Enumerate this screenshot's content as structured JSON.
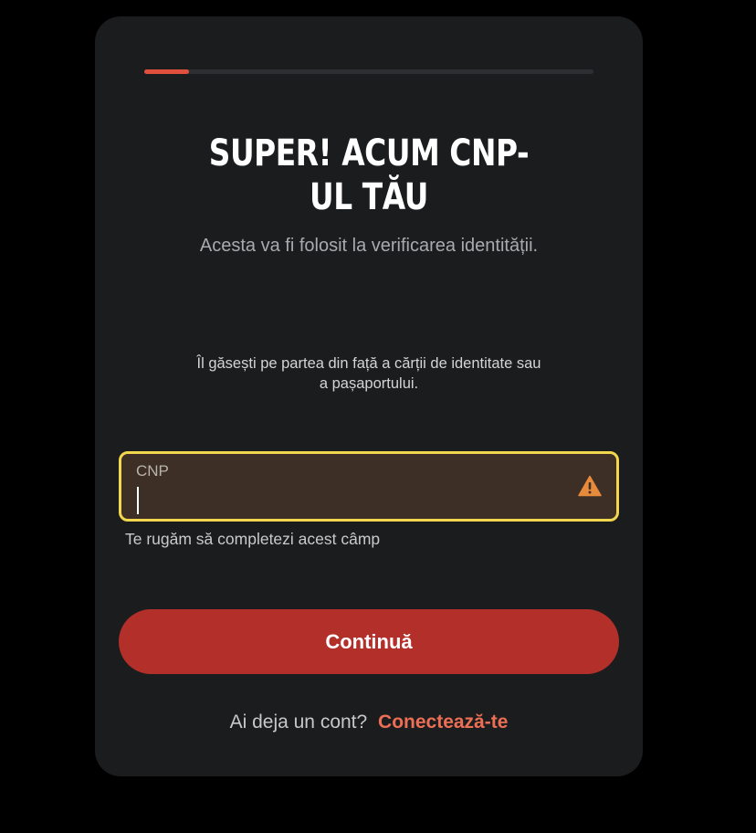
{
  "progress": {
    "value": 0.1
  },
  "header": {
    "title": "SUPER! ACUM CNP-UL TĂU",
    "subtitle": "Acesta va fi folosit la verificarea identității."
  },
  "hint": "Îl găsești pe partea din față a cărții de identitate sau a pașaportului.",
  "cnp_field": {
    "label": "CNP",
    "value": "",
    "icon": "warning-icon",
    "error": "Te rugăm să completezi acest câmp"
  },
  "actions": {
    "continue_label": "Continuă"
  },
  "footer": {
    "prompt": "Ai deja un cont?",
    "link_label": "Conectează-te"
  },
  "colors": {
    "accent": "#b3302a",
    "link": "#ec6f55",
    "field_border": "#f1d64e",
    "warning": "#e88a3c"
  }
}
